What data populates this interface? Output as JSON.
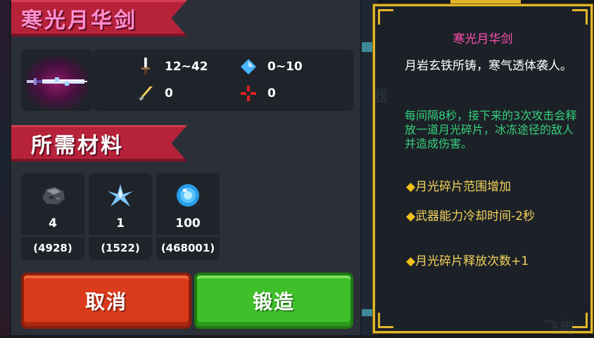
{
  "weapon": {
    "name": "寒光月华剑",
    "stats": {
      "damage": "12~42",
      "energy_cost": "0~10",
      "crit": "0",
      "accuracy": "0"
    }
  },
  "materials_header": "所需材料",
  "materials": [
    {
      "icon": "ore-icon",
      "qty": "4",
      "owned": "(4928)"
    },
    {
      "icon": "crystal-shard-icon",
      "qty": "1",
      "owned": "(1522)"
    },
    {
      "icon": "blue-gem-icon",
      "qty": "100",
      "owned": "(468001)"
    }
  ],
  "buttons": {
    "cancel": "取消",
    "forge": "锻造"
  },
  "tooltip": {
    "title": "寒光月华剑",
    "description": "月岩玄铁所铸，寒气透体袭人。",
    "effect": "每间隔8秒，接下来的3次攻击会释放一道月光碎片，冰冻途径的敌人并造成伤害。",
    "bullets": [
      "月光碎片范围增加",
      "武器能力冷却时间-2秒",
      "月光碎片释放次数+1"
    ]
  },
  "colors": {
    "ribbon": "#b6223a",
    "title_pink": "#ff4fb0",
    "effect_green": "#36d17c",
    "bullet_gold": "#f2d25a",
    "cancel_red": "#d93b1b",
    "forge_green": "#3fc02a",
    "frame_gold": "#e2b62a"
  }
}
